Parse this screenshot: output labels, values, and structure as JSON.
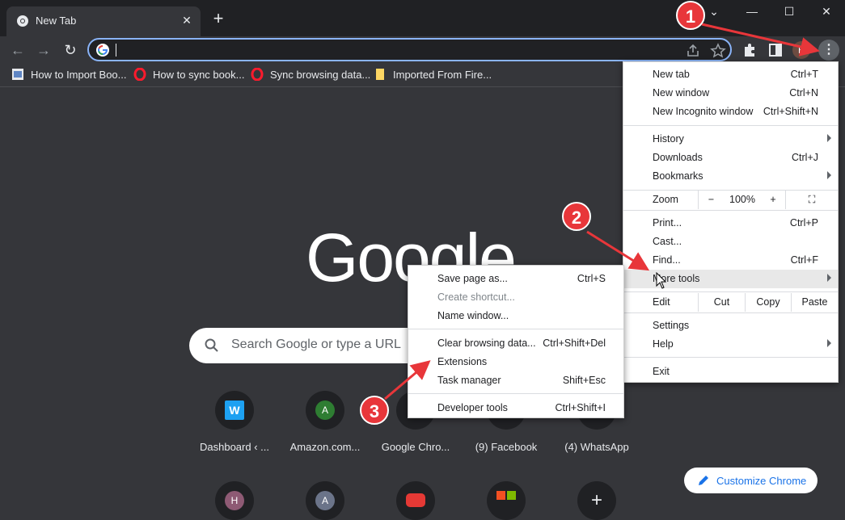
{
  "tab": {
    "title": "New Tab",
    "close_glyph": "✕"
  },
  "newtab_glyph": "+",
  "window": {
    "caret": "⌄",
    "minimize": "—",
    "maximize": "☐",
    "close": "✕"
  },
  "nav": {
    "back": "←",
    "forward": "→",
    "reload": "↻"
  },
  "toolbar": {
    "avatar_letter": "B",
    "menu_glyph": "⋮"
  },
  "bookmarks": [
    {
      "label": "How to Import Boo...",
      "icon": "page-icon"
    },
    {
      "label": "How to sync book...",
      "icon": "opera-icon"
    },
    {
      "label": "Sync browsing data...",
      "icon": "opera-icon"
    },
    {
      "label": "Imported From Fire...",
      "icon": "folder-icon"
    }
  ],
  "logo_text": "Google",
  "search": {
    "placeholder": "Search Google or type a URL"
  },
  "shortcuts": [
    {
      "label": "Dashboard ‹ ...",
      "letter": "W",
      "color": "#1da1f2"
    },
    {
      "label": "Amazon.com...",
      "letter": "A",
      "color": "#2e7d32"
    },
    {
      "label": "Google Chro...",
      "letter": "",
      "color": "#202124"
    },
    {
      "label": "(9) Facebook",
      "letter": "",
      "color": "#202124"
    },
    {
      "label": "(4) WhatsApp",
      "letter": "",
      "color": "#202124"
    }
  ],
  "shortcuts_row2": [
    {
      "letter": "H",
      "color": "#8e5a74"
    },
    {
      "letter": "A",
      "color": "#6b7489"
    },
    {
      "letter": "",
      "color": "#e53935"
    },
    {
      "letter": "",
      "color": "#202124"
    },
    {
      "letter": "+",
      "color": "#202124"
    }
  ],
  "customize": {
    "label": "Customize Chrome"
  },
  "menu": {
    "new_tab": {
      "label": "New tab",
      "shortcut": "Ctrl+T"
    },
    "new_window": {
      "label": "New window",
      "shortcut": "Ctrl+N"
    },
    "new_incognito": {
      "label": "New Incognito window",
      "shortcut": "Ctrl+Shift+N"
    },
    "history": {
      "label": "History"
    },
    "downloads": {
      "label": "Downloads",
      "shortcut": "Ctrl+J"
    },
    "bookmarks": {
      "label": "Bookmarks"
    },
    "zoom": {
      "label": "Zoom",
      "minus": "−",
      "value": "100%",
      "plus": "+",
      "fullscreen": "⛶"
    },
    "print": {
      "label": "Print...",
      "shortcut": "Ctrl+P"
    },
    "cast": {
      "label": "Cast..."
    },
    "find": {
      "label": "Find...",
      "shortcut": "Ctrl+F"
    },
    "more_tools": {
      "label": "More tools"
    },
    "edit": {
      "label": "Edit",
      "cut": "Cut",
      "copy": "Copy",
      "paste": "Paste"
    },
    "settings": {
      "label": "Settings"
    },
    "help": {
      "label": "Help"
    },
    "exit": {
      "label": "Exit"
    }
  },
  "submenu": {
    "save_page": {
      "label": "Save page as...",
      "shortcut": "Ctrl+S"
    },
    "create_shortcut": {
      "label": "Create shortcut..."
    },
    "name_window": {
      "label": "Name window..."
    },
    "clear_data": {
      "label": "Clear browsing data...",
      "shortcut": "Ctrl+Shift+Del"
    },
    "extensions": {
      "label": "Extensions"
    },
    "task_manager": {
      "label": "Task manager",
      "shortcut": "Shift+Esc"
    },
    "dev_tools": {
      "label": "Developer tools",
      "shortcut": "Ctrl+Shift+I"
    }
  },
  "annotations": {
    "step1": "1",
    "step2": "2",
    "step3": "3",
    "color": "#e8363a"
  }
}
